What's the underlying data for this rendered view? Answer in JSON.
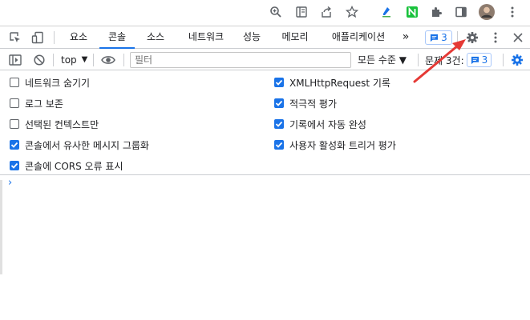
{
  "devtools": {
    "tabs": [
      {
        "label": "요소"
      },
      {
        "label": "콘솔",
        "active": true
      },
      {
        "label": "소스"
      },
      {
        "label": "네트워크"
      },
      {
        "label": "성능"
      },
      {
        "label": "메모리"
      },
      {
        "label": "애플리케이션"
      }
    ],
    "more_tabs": "»",
    "messages_badge": "3"
  },
  "toolbar": {
    "context": "top",
    "filter_placeholder": "필터",
    "level": "모든 수준 ▼",
    "issues_label": "문제 3건:",
    "issues_count": "3"
  },
  "settings": {
    "left": [
      {
        "label": "네트워크 숨기기",
        "checked": false
      },
      {
        "label": "로그 보존",
        "checked": false
      },
      {
        "label": "선택된 컨텍스트만",
        "checked": false
      },
      {
        "label": "콘솔에서 유사한 메시지 그룹화",
        "checked": true
      },
      {
        "label": "콘솔에 CORS 오류 표시",
        "checked": true
      }
    ],
    "right": [
      {
        "label": "XMLHttpRequest 기록",
        "checked": true
      },
      {
        "label": "적극적 평가",
        "checked": true
      },
      {
        "label": "기록에서 자동 완성",
        "checked": true
      },
      {
        "label": "사용자 활성화 트리거 평가",
        "checked": true
      }
    ]
  },
  "console": {
    "prompt": "›"
  },
  "colors": {
    "accent": "#1a73e8",
    "arrow": "#e53935"
  }
}
